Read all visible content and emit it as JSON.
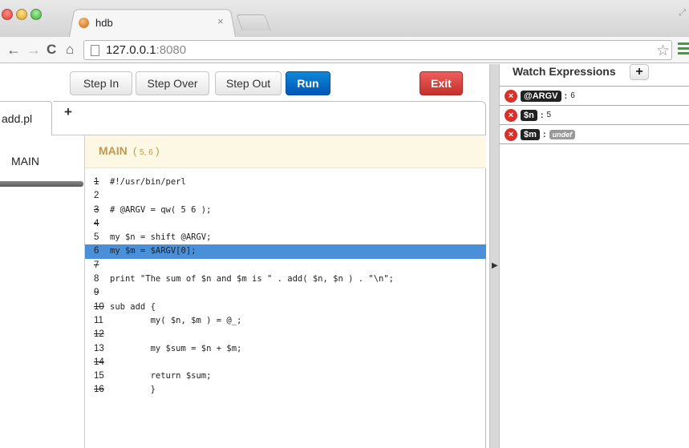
{
  "browser": {
    "tab_title": "hdb",
    "tab_close": "×",
    "url_host": "127.0.0.1",
    "url_port": ":8080"
  },
  "controls": {
    "step_in": "Step In",
    "step_over": "Step Over",
    "step_out": "Step Out",
    "run": "Run",
    "exit": "Exit"
  },
  "file_tabs": [
    {
      "label": "add.pl",
      "active": true
    }
  ],
  "add_tab_label": "+",
  "stack": [
    {
      "label": "MAIN",
      "selected": true
    }
  ],
  "frame": {
    "name": "MAIN",
    "args_open": "(",
    "args": "5, 6",
    "args_close": ")"
  },
  "code": [
    {
      "no": "1",
      "text": "#!/usr/bin/perl",
      "breakable": false
    },
    {
      "no": "2",
      "text": "",
      "breakable": true
    },
    {
      "no": "3",
      "text": "# @ARGV = qw( 5 6 );",
      "breakable": false
    },
    {
      "no": "4",
      "text": "",
      "breakable": false
    },
    {
      "no": "5",
      "text": "my $n = shift @ARGV;",
      "breakable": true
    },
    {
      "no": "6",
      "text": "my $m = $ARGV[0];",
      "breakable": true,
      "current": true
    },
    {
      "no": "7",
      "text": "",
      "breakable": false
    },
    {
      "no": "8",
      "text": "print \"The sum of $n and $m is \" . add( $n, $n ) . \"\\n\";",
      "breakable": true
    },
    {
      "no": "9",
      "text": "",
      "breakable": false
    },
    {
      "no": "10",
      "text": "sub add {",
      "breakable": false
    },
    {
      "no": "11",
      "text": "        my( $n, $m ) = @_;",
      "breakable": true
    },
    {
      "no": "12",
      "text": "",
      "breakable": false
    },
    {
      "no": "13",
      "text": "        my $sum = $n + $m;",
      "breakable": true
    },
    {
      "no": "14",
      "text": "",
      "breakable": false
    },
    {
      "no": "15",
      "text": "        return $sum;",
      "breakable": true
    },
    {
      "no": "16",
      "text": "        }",
      "breakable": false
    }
  ],
  "watch": {
    "title": "Watch Expressions",
    "add_label": "+",
    "expressions": [
      {
        "name": "@ARGV",
        "value": "6"
      },
      {
        "name": "$n",
        "value": "5"
      },
      {
        "name": "$m",
        "value": "undef",
        "undefined": true
      }
    ]
  },
  "colors": {
    "current_line": "#4a90d9",
    "run_button": "#0056b8",
    "exit_button": "#c4302b",
    "frame_header": "#fcf8e3"
  },
  "icons": {
    "back": "arrow-left-icon",
    "forward": "arrow-right-icon",
    "reload": "reload-icon",
    "home": "home-icon",
    "bookmark": "star-icon",
    "menu": "hamburger-icon",
    "remove_watch": "remove-circle-icon",
    "splitter": "chevron-right-icon"
  }
}
